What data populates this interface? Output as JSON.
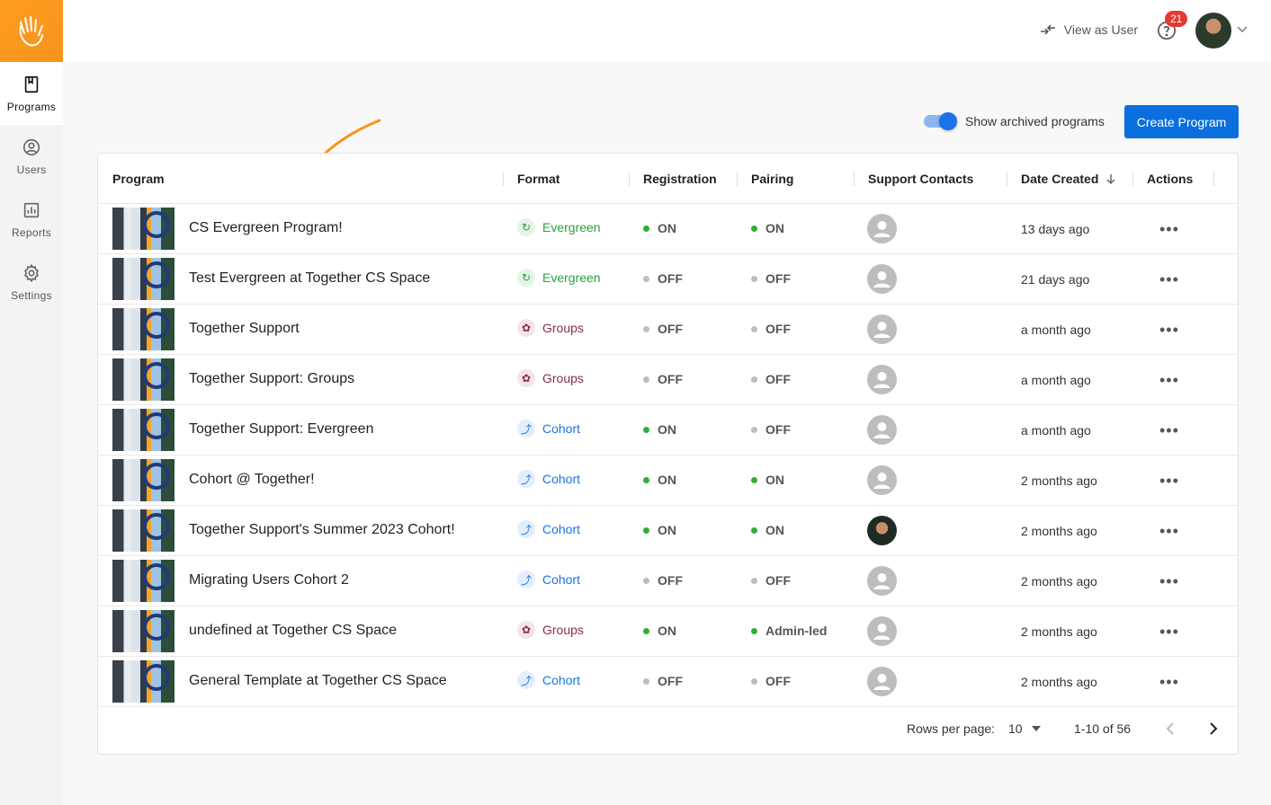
{
  "sidebar": {
    "items": [
      {
        "label": "Programs",
        "icon": "bookmark-icon",
        "active": true
      },
      {
        "label": "Users",
        "icon": "user-circle-icon"
      },
      {
        "label": "Reports",
        "icon": "bar-chart-icon"
      },
      {
        "label": "Settings",
        "icon": "gear-icon"
      }
    ]
  },
  "topbar": {
    "view_as_user": "View as User",
    "notification_count": "21"
  },
  "controls": {
    "archived_label": "Show archived programs",
    "create_button": "Create Program"
  },
  "table": {
    "headers": {
      "program": "Program",
      "format": "Format",
      "registration": "Registration",
      "pairing": "Pairing",
      "support": "Support Contacts",
      "date": "Date Created",
      "actions": "Actions"
    },
    "rows": [
      {
        "name": "CS Evergreen Program!",
        "format": "Evergreen",
        "registration": "ON",
        "pairing": "ON",
        "date": "13 days ago"
      },
      {
        "name": "Test Evergreen at Together CS Space",
        "format": "Evergreen",
        "registration": "OFF",
        "pairing": "OFF",
        "date": "21 days ago"
      },
      {
        "name": "Together Support",
        "format": "Groups",
        "registration": "OFF",
        "pairing": "OFF",
        "date": "a month ago"
      },
      {
        "name": "Together Support: Groups",
        "format": "Groups",
        "registration": "OFF",
        "pairing": "OFF",
        "date": "a month ago"
      },
      {
        "name": "Together Support: Evergreen",
        "format": "Cohort",
        "registration": "ON",
        "pairing": "OFF",
        "date": "a month ago"
      },
      {
        "name": "Cohort @ Together!",
        "format": "Cohort",
        "registration": "ON",
        "pairing": "ON",
        "date": "2 months ago"
      },
      {
        "name": "Together Support's Summer 2023 Cohort!",
        "format": "Cohort",
        "registration": "ON",
        "pairing": "ON",
        "date": "2 months ago",
        "contact_photo": true
      },
      {
        "name": "Migrating Users Cohort 2",
        "format": "Cohort",
        "registration": "OFF",
        "pairing": "OFF",
        "date": "2 months ago"
      },
      {
        "name": "undefined at Together CS Space",
        "format": "Groups",
        "registration": "ON",
        "pairing": "Admin-led",
        "date": "2 months ago"
      },
      {
        "name": "General Template at Together CS Space",
        "format": "Cohort",
        "registration": "OFF",
        "pairing": "OFF",
        "date": "2 months ago"
      }
    ],
    "actions_glyph": "•••"
  },
  "pagination": {
    "rows_per_page_label": "Rows per page:",
    "rows_per_page": "10",
    "range": "1-10 of 56"
  },
  "colors": {
    "brand": "#f7931e",
    "primary": "#0b6fde",
    "evergreen": "#2e9e3e",
    "groups": "#8a2a4f",
    "cohort": "#1a73e8",
    "on": "#2bb034",
    "off": "#bdbdbd"
  }
}
